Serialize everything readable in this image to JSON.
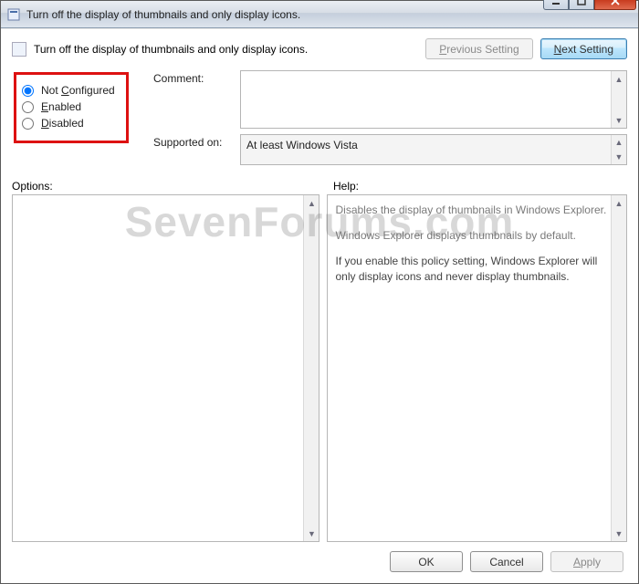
{
  "window": {
    "title": "Turn off the display of thumbnails and only display icons."
  },
  "header": {
    "description": "Turn off the display of thumbnails and only display icons."
  },
  "nav": {
    "prev_prefix": "P",
    "prev_rest": "revious Setting",
    "next_prefix": "N",
    "next_rest": "ext Setting"
  },
  "state": {
    "not_configured_pre": "Not ",
    "not_configured_u": "C",
    "not_configured_post": "onfigured",
    "enabled_u": "E",
    "enabled_post": "nabled",
    "disabled_u": "D",
    "disabled_post": "isabled"
  },
  "fields": {
    "comment_label": "Comment:",
    "supported_label": "Supported on:",
    "supported_value": "At least Windows Vista"
  },
  "sections": {
    "options_label": "Options:",
    "help_label": "Help:"
  },
  "help": {
    "p1": "Disables the display of thumbnails in Windows Explorer.",
    "p2": "Windows Explorer displays thumbnails by default.",
    "p3": "If you enable this policy setting, Windows Explorer will only display icons and never display thumbnails."
  },
  "footer": {
    "ok": "OK",
    "cancel": "Cancel",
    "apply_u": "A",
    "apply_post": "pply"
  },
  "watermark": "SevenForums.com"
}
